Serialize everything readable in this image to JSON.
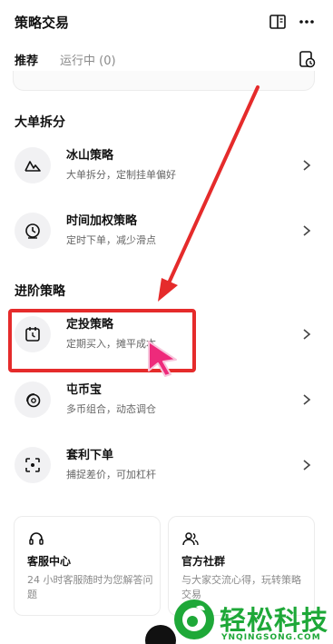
{
  "header": {
    "title": "策略交易"
  },
  "tabs": [
    {
      "label": "推荐"
    },
    {
      "label": "运行中 (0)"
    }
  ],
  "sections": [
    {
      "title": "大单拆分",
      "items": [
        {
          "title": "冰山策略",
          "desc": "大单拆分，定制挂单偏好",
          "icon": "mountain-icon"
        },
        {
          "title": "时间加权策略",
          "desc": "定时下单，减少滑点",
          "icon": "clock-icon"
        }
      ]
    },
    {
      "title": "进阶策略",
      "items": [
        {
          "title": "定投策略",
          "desc": "定期买入，摊平成本",
          "icon": "calendar-icon"
        },
        {
          "title": "屯币宝",
          "desc": "多币组合，动态调仓",
          "icon": "coin-icon"
        },
        {
          "title": "套利下单",
          "desc": "捕捉差价，可加杠杆",
          "icon": "scan-icon"
        }
      ]
    }
  ],
  "cards": [
    {
      "title": "客服中心",
      "desc": "24 小时客服随时为您解答问题",
      "icon": "headset-icon"
    },
    {
      "title": "官方社群",
      "desc": "与大家交流心得，玩转策略交易",
      "icon": "people-icon"
    }
  ],
  "watermark": {
    "name": "轻松科技",
    "domain": "YNQINGSONG.COM"
  },
  "colors": {
    "highlight": "#e52b2b",
    "watermark": "#1ea838",
    "cursor": "#ee2a7b"
  }
}
